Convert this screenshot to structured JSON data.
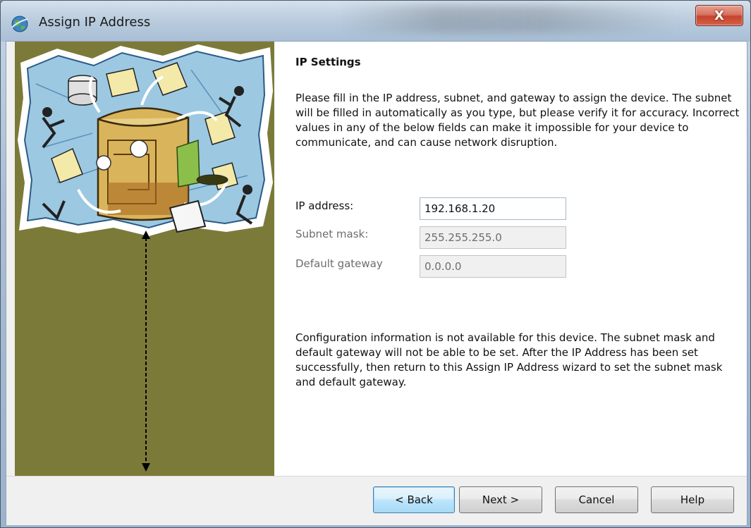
{
  "window": {
    "title": "Assign IP Address",
    "close_label": "X"
  },
  "content": {
    "heading": "IP Settings",
    "intro": "Please fill in the IP address, subnet, and gateway to assign the device. The subnet will be filled in automatically as you type, but please verify it for accuracy.  Incorrect values in any of the below fields can make it impossible for your device to communicate, and can cause network disruption.",
    "fields": {
      "ip_label": "IP address:",
      "ip_value": "192.168.1.20",
      "subnet_label": "Subnet mask:",
      "subnet_value": "255.255.255.0",
      "gateway_label": "Default gateway",
      "gateway_value": "0.0.0.0"
    },
    "note": "Configuration information is not available for this device.  The subnet mask and default gateway will not be able to be set.  After the IP Address has been set successfully, then return to this Assign IP Address wizard to set the subnet mask and default gateway."
  },
  "buttons": {
    "back": "< Back",
    "next": "Next >",
    "cancel": "Cancel",
    "help": "Help"
  },
  "colors": {
    "side_panel": "#7c7a39",
    "close_button": "#c7432c",
    "default_button_border": "#3c7fb1"
  },
  "icons": {
    "app_icon": "network-globe-icon",
    "illustration": "network-devices-illustration",
    "arrow": "vertical-double-arrow-icon"
  }
}
